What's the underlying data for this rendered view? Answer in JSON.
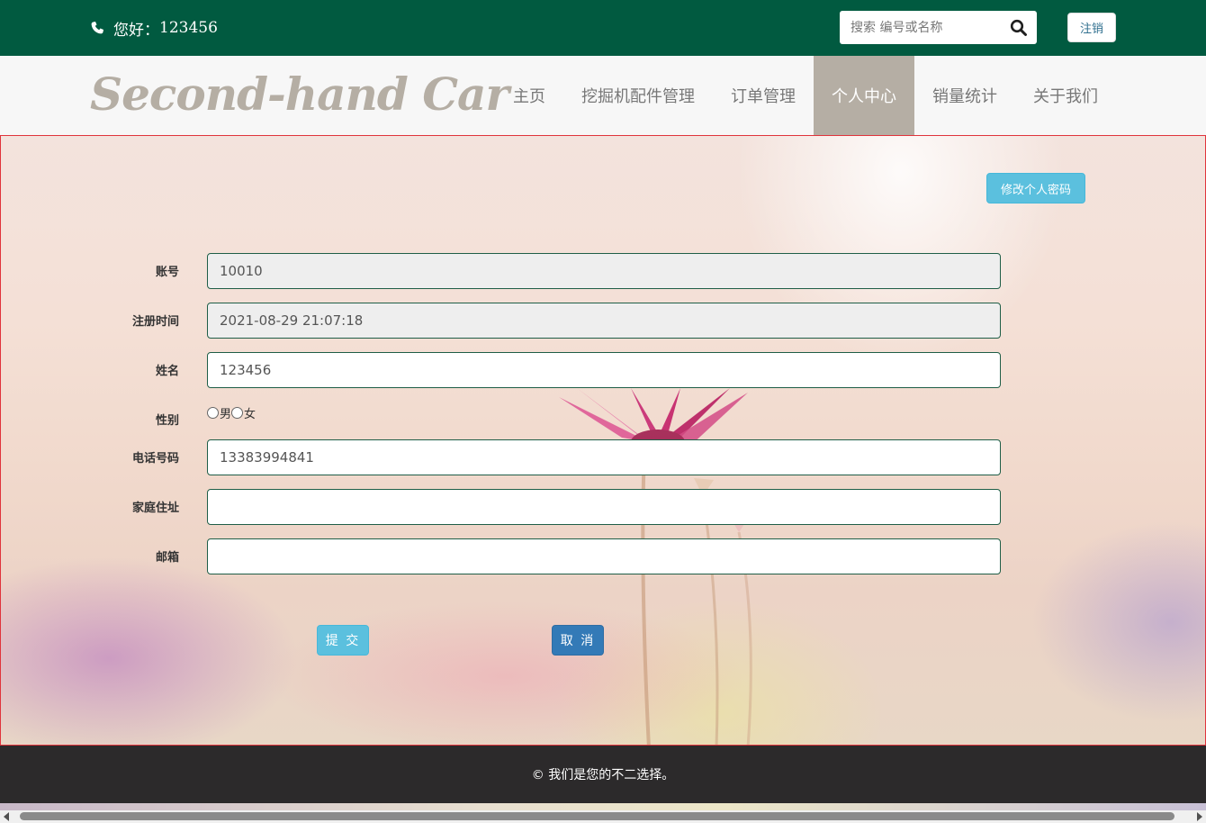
{
  "topbar": {
    "greeting_label": "您好：",
    "username": "123456",
    "search_placeholder": "搜索 编号或名称",
    "logout_label": "注销",
    "background_color": "#015a40"
  },
  "navbar": {
    "logo_text": "Second-hand Car",
    "items": [
      {
        "label": "主页",
        "active": false
      },
      {
        "label": "挖掘机配件管理",
        "active": false
      },
      {
        "label": "订单管理",
        "active": false
      },
      {
        "label": "个人中心",
        "active": true
      },
      {
        "label": "销量统计",
        "active": false
      },
      {
        "label": "关于我们",
        "active": false
      }
    ]
  },
  "main": {
    "change_password_label": "修改个人密码",
    "form": {
      "account": {
        "label": "账号",
        "value": "10010"
      },
      "register_time": {
        "label": "注册时间",
        "value": "2021-08-29 21:07:18"
      },
      "name": {
        "label": "姓名",
        "value": "123456"
      },
      "gender": {
        "label": "性别",
        "options": [
          "男",
          "女"
        ],
        "selected": null
      },
      "phone": {
        "label": "电话号码",
        "value": "13383994841"
      },
      "address": {
        "label": "家庭住址",
        "value": ""
      },
      "email": {
        "label": "邮箱",
        "value": ""
      }
    },
    "submit_label": "提 交",
    "cancel_label": "取 消"
  },
  "footer": {
    "text": "© 我们是您的不二选择。"
  },
  "colors": {
    "accent": "#015a40",
    "nav_active": "#b5aea4",
    "info_button": "#5bc0de",
    "primary_button": "#337ab7",
    "footer_bg": "#2c2a2b"
  }
}
